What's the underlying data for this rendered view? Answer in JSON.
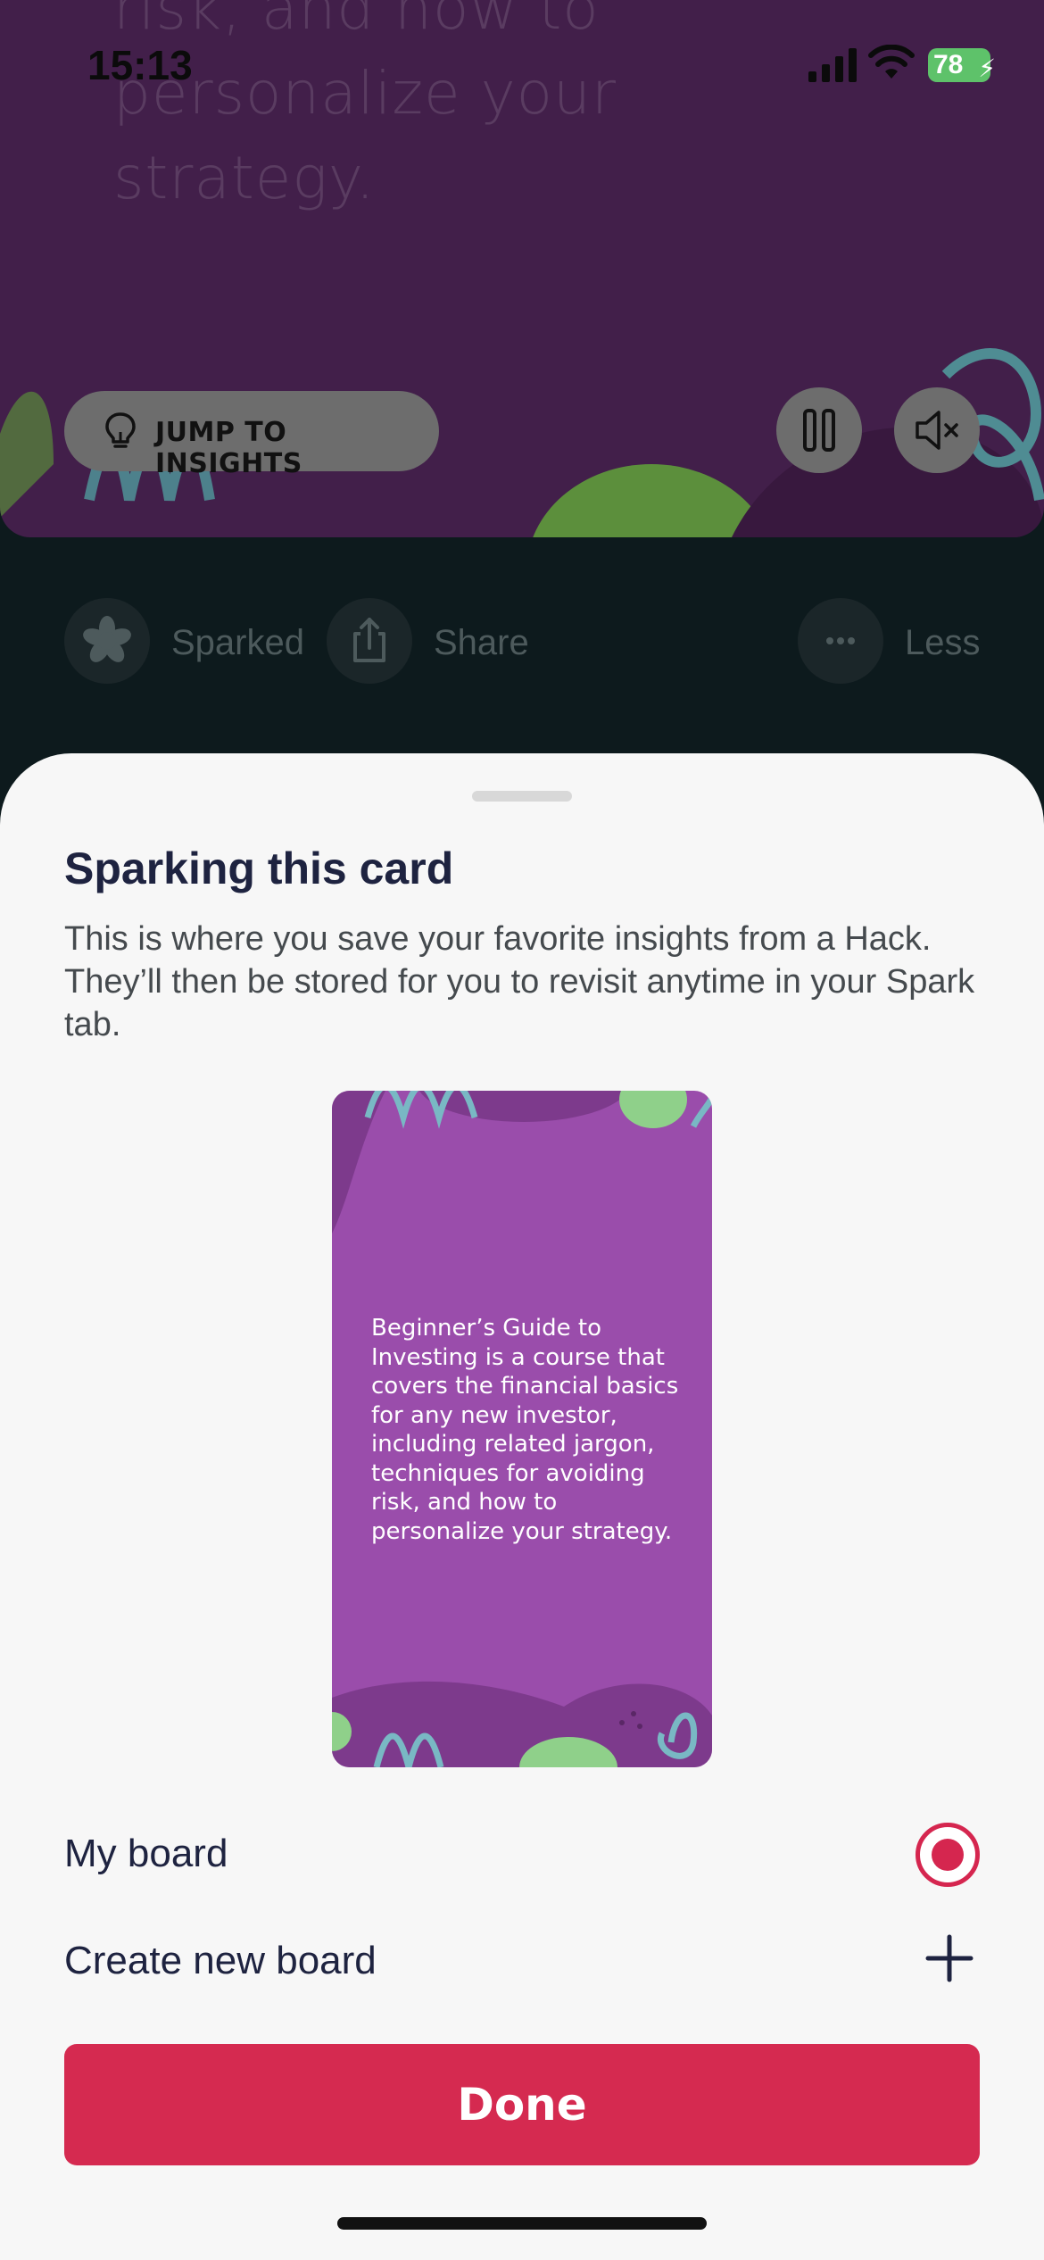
{
  "status_bar": {
    "time": "15:13",
    "battery": "78"
  },
  "video": {
    "background_text": "risk, and how to personalize your strategy.",
    "jump_label": "JUMP TO INSIGHTS"
  },
  "actions": {
    "sparked_label": "Sparked",
    "share_label": "Share",
    "less_label": "Less"
  },
  "sheet": {
    "title": "Sparking this card",
    "description": "This is where you save your favorite insights from a Hack. They’ll then be stored for you to revisit anytime in your Spark tab.",
    "card_text": "Beginner’s Guide to Investing is a course that covers the financial basics for any new investor, including related jargon, techniques for avoiding risk, and how to personalize your strategy.",
    "options": [
      {
        "label": "My board",
        "selected": true
      },
      {
        "label": "Create new board"
      }
    ],
    "done_label": "Done"
  },
  "colors": {
    "accent": "#d52a50",
    "video_bg": "#421f4a",
    "card_bg": "#9a4dab",
    "battery": "#5ec26a"
  }
}
